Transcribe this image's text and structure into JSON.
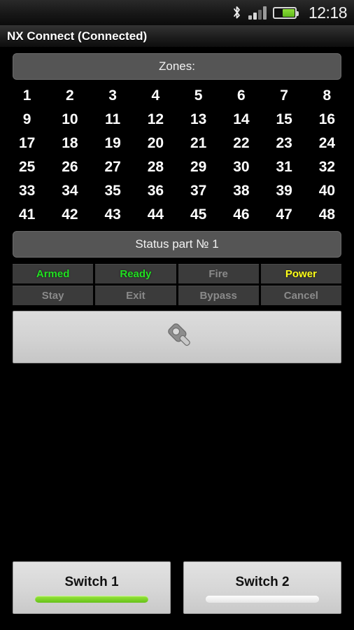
{
  "statusbar": {
    "clock": "12:18",
    "icons": [
      "bluetooth-icon",
      "signal-icon",
      "battery-icon"
    ],
    "signal_bars_total": 4,
    "signal_bars_active": 2,
    "battery_level_percent": 57
  },
  "titlebar": {
    "title": "NX Connect (Connected)"
  },
  "zones_header": {
    "label": "Zones:"
  },
  "zones": {
    "numbers": [
      "1",
      "2",
      "3",
      "4",
      "5",
      "6",
      "7",
      "8",
      "9",
      "10",
      "11",
      "12",
      "13",
      "14",
      "15",
      "16",
      "17",
      "18",
      "19",
      "20",
      "21",
      "22",
      "23",
      "24",
      "25",
      "26",
      "27",
      "28",
      "29",
      "30",
      "31",
      "32",
      "33",
      "34",
      "35",
      "36",
      "37",
      "38",
      "39",
      "40",
      "41",
      "42",
      "43",
      "44",
      "45",
      "46",
      "47",
      "48"
    ],
    "columns": 8,
    "rows": 6
  },
  "status_header": {
    "label": "Status part № 1"
  },
  "status_cells": [
    {
      "label": "Armed",
      "state": "active-green"
    },
    {
      "label": "Ready",
      "state": "active-green"
    },
    {
      "label": "Fire",
      "state": "inactive"
    },
    {
      "label": "Power",
      "state": "active-yellow"
    },
    {
      "label": "Stay",
      "state": "inactive"
    },
    {
      "label": "Exit",
      "state": "inactive"
    },
    {
      "label": "Bypass",
      "state": "inactive"
    },
    {
      "label": "Cancel",
      "state": "inactive"
    }
  ],
  "key_button": {
    "icon": "key-icon"
  },
  "switches": [
    {
      "label": "Switch 1",
      "state": "on"
    },
    {
      "label": "Switch 2",
      "state": "off"
    }
  ],
  "colors": {
    "screen_background": "#000000",
    "header_bar": "#555555",
    "status_cell": "#3b3b3b",
    "active_green": "#22e022",
    "active_yellow": "#ffff1a",
    "inactive_gray": "#8a8a8a",
    "button_light": "#d6d6d6",
    "indicator_on": "#7fd42b",
    "indicator_off": "#f0f0f0"
  }
}
